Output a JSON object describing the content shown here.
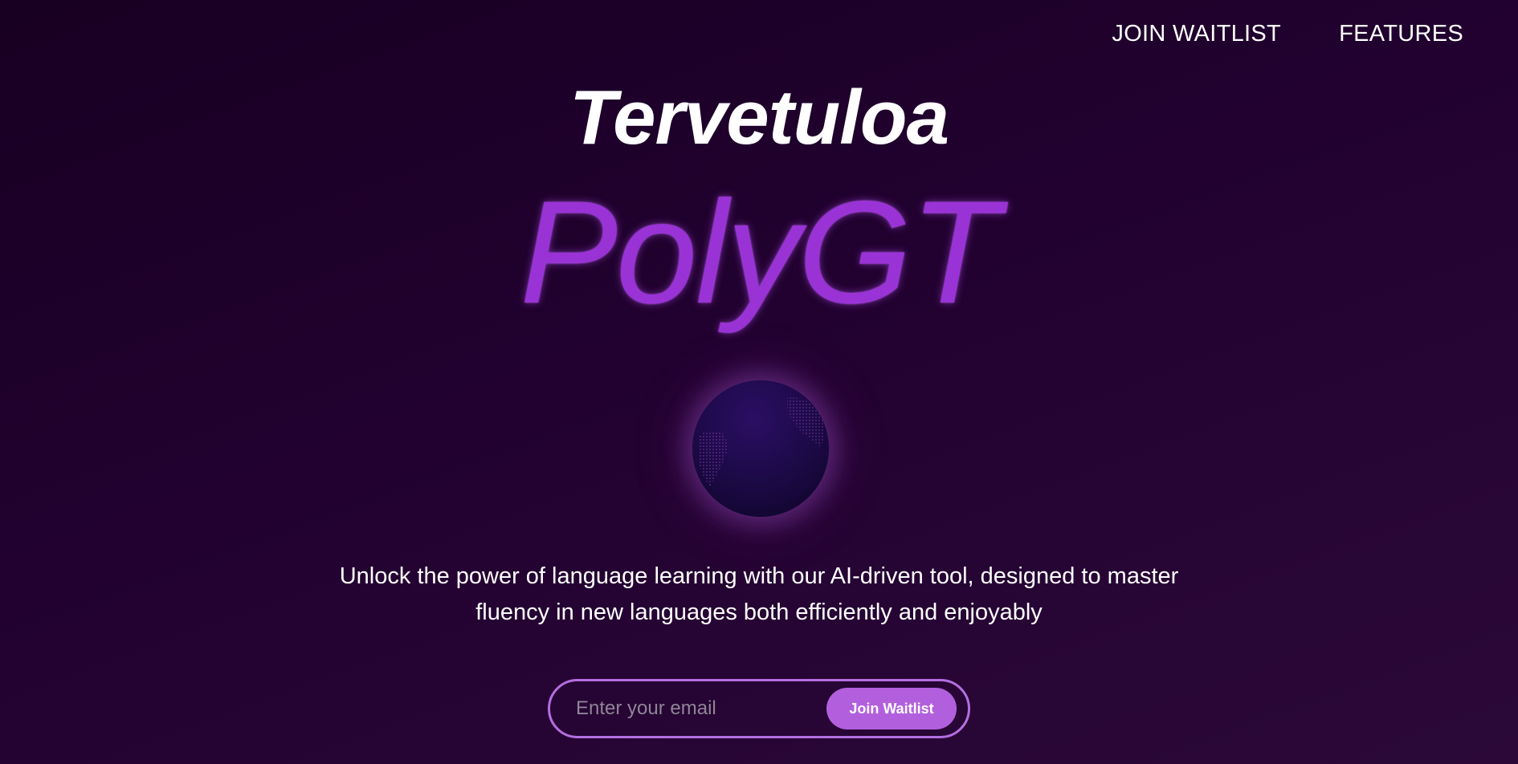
{
  "nav": {
    "items": [
      {
        "label": "JOIN WAITLIST"
      },
      {
        "label": "FEATURES"
      }
    ]
  },
  "hero": {
    "greeting": "Tervetuloa",
    "brand": "PolyGT",
    "tagline_line1": "Unlock the power of language learning with our AI-driven tool, designed to master",
    "tagline_line2": "fluency in new languages both efficiently and enjoyably"
  },
  "globe": {
    "icon": "globe-icon"
  },
  "signup": {
    "email_placeholder": "Enter your email",
    "email_value": "",
    "button_label": "Join Waitlist"
  },
  "colors": {
    "brand": "#9a33d6",
    "accent": "#b25fde",
    "background": "#1e012b"
  }
}
